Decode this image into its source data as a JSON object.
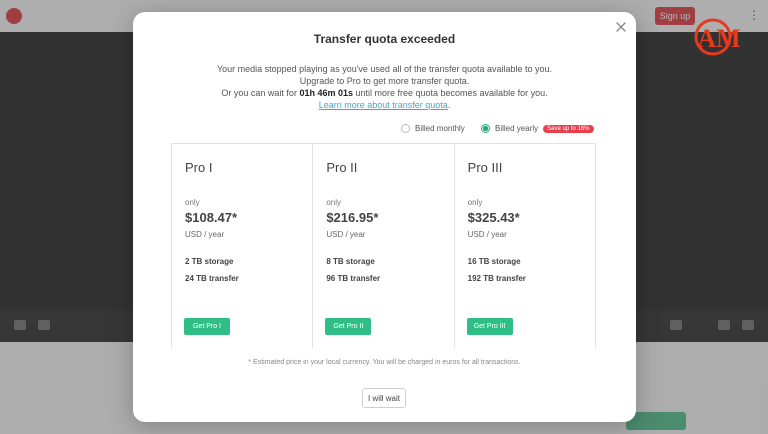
{
  "background": {
    "signup_label": "Sign up",
    "menu_glyph": "⋮"
  },
  "watermark": {
    "text": "AM"
  },
  "modal": {
    "title": "Transfer quota exceeded",
    "line1": "Your media stopped playing as you've used all of the transfer quota available to you.",
    "line2": "Upgrade to Pro to get more transfer quota.",
    "line3_prefix": "Or you can wait for ",
    "line3_time": "01h 46m 01s",
    "line3_suffix": " until more free quota becomes available for you.",
    "learn_more": "Learn more about transfer quota",
    "learn_more_suffix": ".",
    "billing": {
      "monthly_label": "Billed monthly",
      "yearly_label": "Billed yearly",
      "save_badge": "Save up to 16%",
      "selected": "yearly"
    },
    "plans": [
      {
        "name": "Pro I",
        "only": "only",
        "price": "$108.47*",
        "per": "USD / year",
        "storage": "2 TB storage",
        "transfer": "24 TB transfer",
        "button": "Get Pro I"
      },
      {
        "name": "Pro II",
        "only": "only",
        "price": "$216.95*",
        "per": "USD / year",
        "storage": "8 TB storage",
        "transfer": "96 TB transfer",
        "button": "Get Pro II"
      },
      {
        "name": "Pro III",
        "only": "only",
        "price": "$325.43*",
        "per": "USD / year",
        "storage": "16 TB storage",
        "transfer": "192 TB transfer",
        "button": "Get Pro III"
      }
    ],
    "note": "* Estimated price in your local currency. You will be charged in euros for all transactions.",
    "wait_button": "I will wait"
  },
  "colors": {
    "accent_green": "#2fbf86",
    "badge_red": "#e6404e",
    "link_blue": "#4aa3c7"
  }
}
